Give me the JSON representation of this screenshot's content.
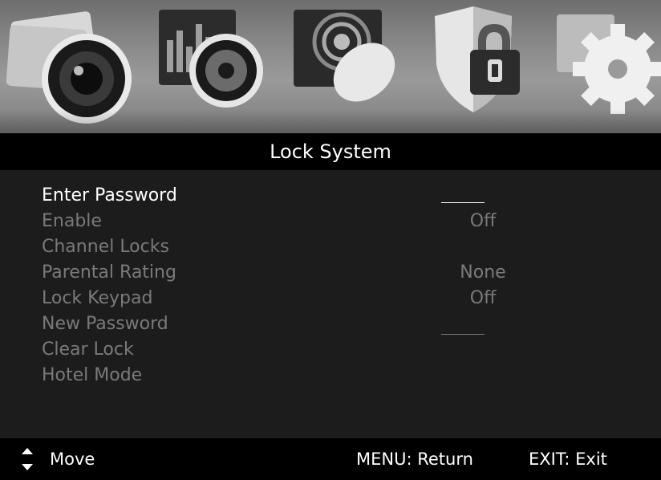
{
  "tabs": [
    {
      "icon": "picture-icon"
    },
    {
      "icon": "sound-icon"
    },
    {
      "icon": "channel-icon"
    },
    {
      "icon": "lock-icon"
    },
    {
      "icon": "setup-icon"
    }
  ],
  "title": "Lock System",
  "menu": [
    {
      "label": "Enter Password",
      "value": "",
      "field": "password-blank",
      "active": true
    },
    {
      "label": "Enable",
      "value": "Off"
    },
    {
      "label": "Channel Locks",
      "value": ""
    },
    {
      "label": "Parental Rating",
      "value": "None"
    },
    {
      "label": "Lock Keypad",
      "value": "Off"
    },
    {
      "label": "New Password",
      "value": "",
      "field": "password-blank"
    },
    {
      "label": "Clear Lock",
      "value": ""
    },
    {
      "label": "Hotel Mode",
      "value": ""
    }
  ],
  "footer": {
    "move": "Move",
    "menu_return": "MENU: Return",
    "exit": "EXIT: Exit"
  }
}
